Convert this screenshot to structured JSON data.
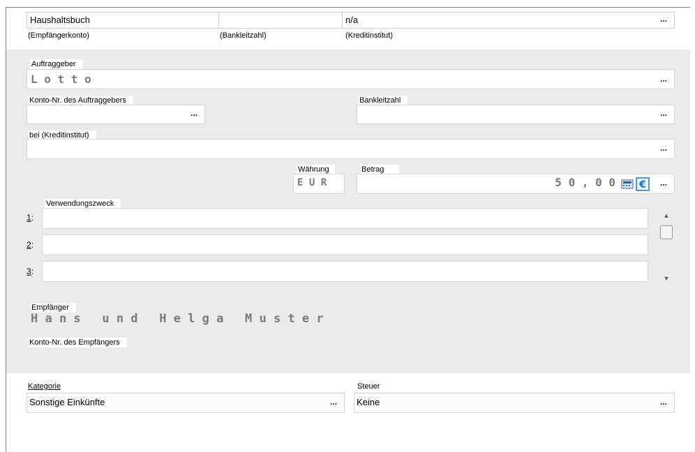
{
  "header": {
    "account_value": "Haushaltsbuch",
    "account_caption": "(Empfängerkonto)",
    "blz_value": "",
    "blz_caption": "(Bankleitzahl)",
    "institute_value": "n/a",
    "institute_caption": "(Kreditinstitut)"
  },
  "auftraggeber": {
    "label": "Auftraggeber",
    "value": "L o t t o"
  },
  "konto_auftraggeber": {
    "label": "Konto-Nr. des Auftraggebers",
    "value": ""
  },
  "bankleitzahl": {
    "label": "Bankleitzahl",
    "value": ""
  },
  "kreditinstitut": {
    "label": "bei (Kreditinstitut)",
    "value": ""
  },
  "waehrung": {
    "label": "Währung",
    "value": "E U R"
  },
  "betrag": {
    "label": "Betrag",
    "value": "5 0 , 0 0"
  },
  "verwendungszweck": {
    "label": "Verwendungszweck",
    "lines": [
      {
        "index": "1",
        "value": ""
      },
      {
        "index": "2",
        "value": ""
      },
      {
        "index": "3",
        "value": ""
      }
    ]
  },
  "empfaenger": {
    "label": "Empfänger",
    "value": "H a n s   u n d   H e l g a   M u s t e r"
  },
  "konto_empfaenger": {
    "label": "Konto-Nr. des Empfängers"
  },
  "kategorie": {
    "label": "Kategorie",
    "value": "Sonstige Einkünfte"
  },
  "steuer": {
    "label": "Steuer",
    "value": "Keine"
  },
  "ellipsis": "...",
  "colors": {
    "panel_bg": "#ebebeb",
    "field_border": "#d6d6d6",
    "mono_text": "#7a7a7a",
    "euro_blue": "#1e73c8"
  }
}
